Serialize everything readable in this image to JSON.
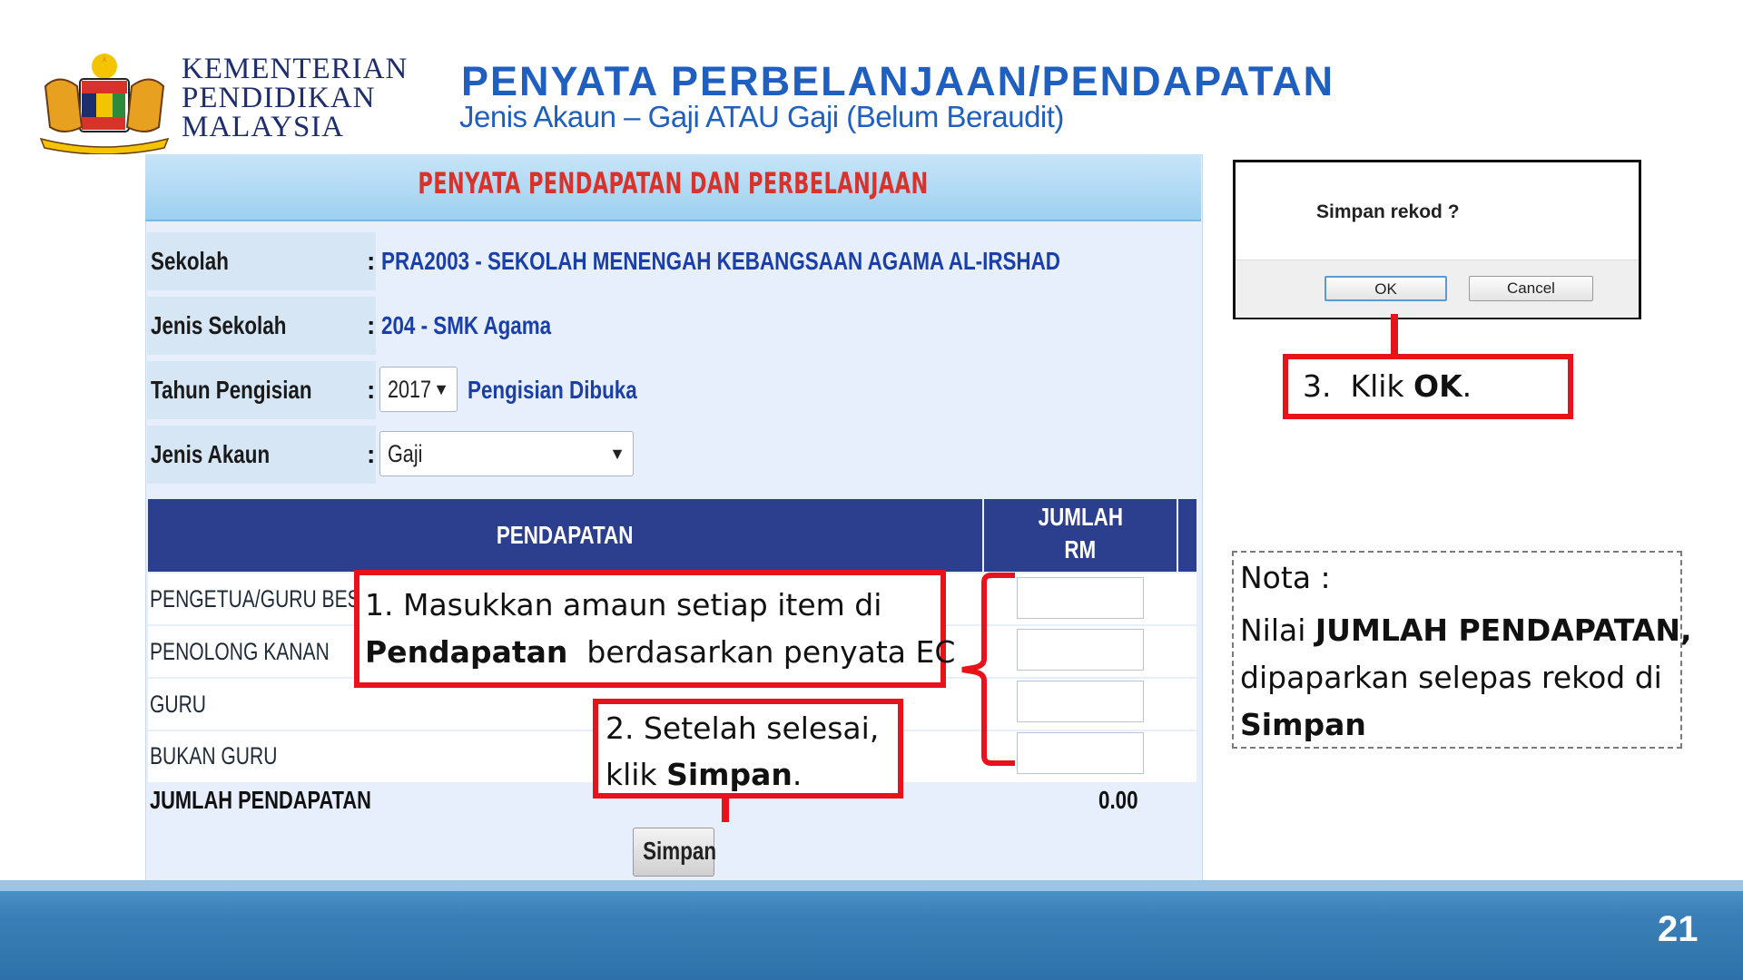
{
  "header": {
    "ministry_lines": [
      "KEMENTERIAN",
      "PENDIDIKAN",
      "MALAYSIA"
    ],
    "title": "PENYATA PERBELANJAAN/PENDAPATAN",
    "subtitle": "Jenis Akaun – Gaji ATAU Gaji (Belum Beraudit)",
    "logo_icon": "malaysia-coat-of-arms-icon"
  },
  "form": {
    "title": "PENYATA PENDAPATAN DAN PERBELANJAAN",
    "fields": [
      {
        "label": "Sekolah",
        "value": "PRA2003 - SEKOLAH MENENGAH KEBANGSAAN AGAMA AL-IRSHAD"
      },
      {
        "label": "Jenis Sekolah",
        "value": "204 -  SMK Agama"
      },
      {
        "label": "Tahun Pengisian",
        "select_value": "2017",
        "status": "Pengisian Dibuka"
      },
      {
        "label": "Jenis Akaun",
        "select_value": "Gaji"
      }
    ],
    "colon": ":",
    "table": {
      "header_pendapatan": "PENDAPATAN",
      "header_jumlah": [
        "JUMLAH",
        "RM"
      ],
      "rows": [
        "PENGETUA/GURU BESAR",
        "PENOLONG KANAN",
        "GURU",
        "BUKAN GURU"
      ],
      "total_label": "JUMLAH PENDAPATAN",
      "total_value": "0.00"
    },
    "save_label": "Simpan"
  },
  "callouts": {
    "step1_line1": "1. Masukkan amaun setiap item di",
    "step1_bold": "Pendapatan",
    "step1_rest": "  berdasarkan penyata EC",
    "step2_line1": "2. Setelah selesai,",
    "step2_prefix": "klik ",
    "step2_bold": "Simpan",
    "step2_suffix": ".",
    "step3_prefix": "3.  Klik ",
    "step3_bold": "OK",
    "step3_suffix": "."
  },
  "dialog": {
    "message": "Simpan rekod ?",
    "ok_label": "OK",
    "cancel_label": "Cancel"
  },
  "note": {
    "title": "Nota :",
    "prefix": "Nilai ",
    "bold1": "JUMLAH PENDAPATAN,",
    "middle": "dipaparkan selepas rekod di",
    "bold2": "Simpan"
  },
  "footer": {
    "page_number": "21"
  },
  "colors": {
    "title_blue": "#1f5fbf",
    "header_navy": "#2b3f8e",
    "callout_red": "#e8131a",
    "form_title_red": "#d8322a",
    "footer_blue": "#3a7fb7"
  }
}
